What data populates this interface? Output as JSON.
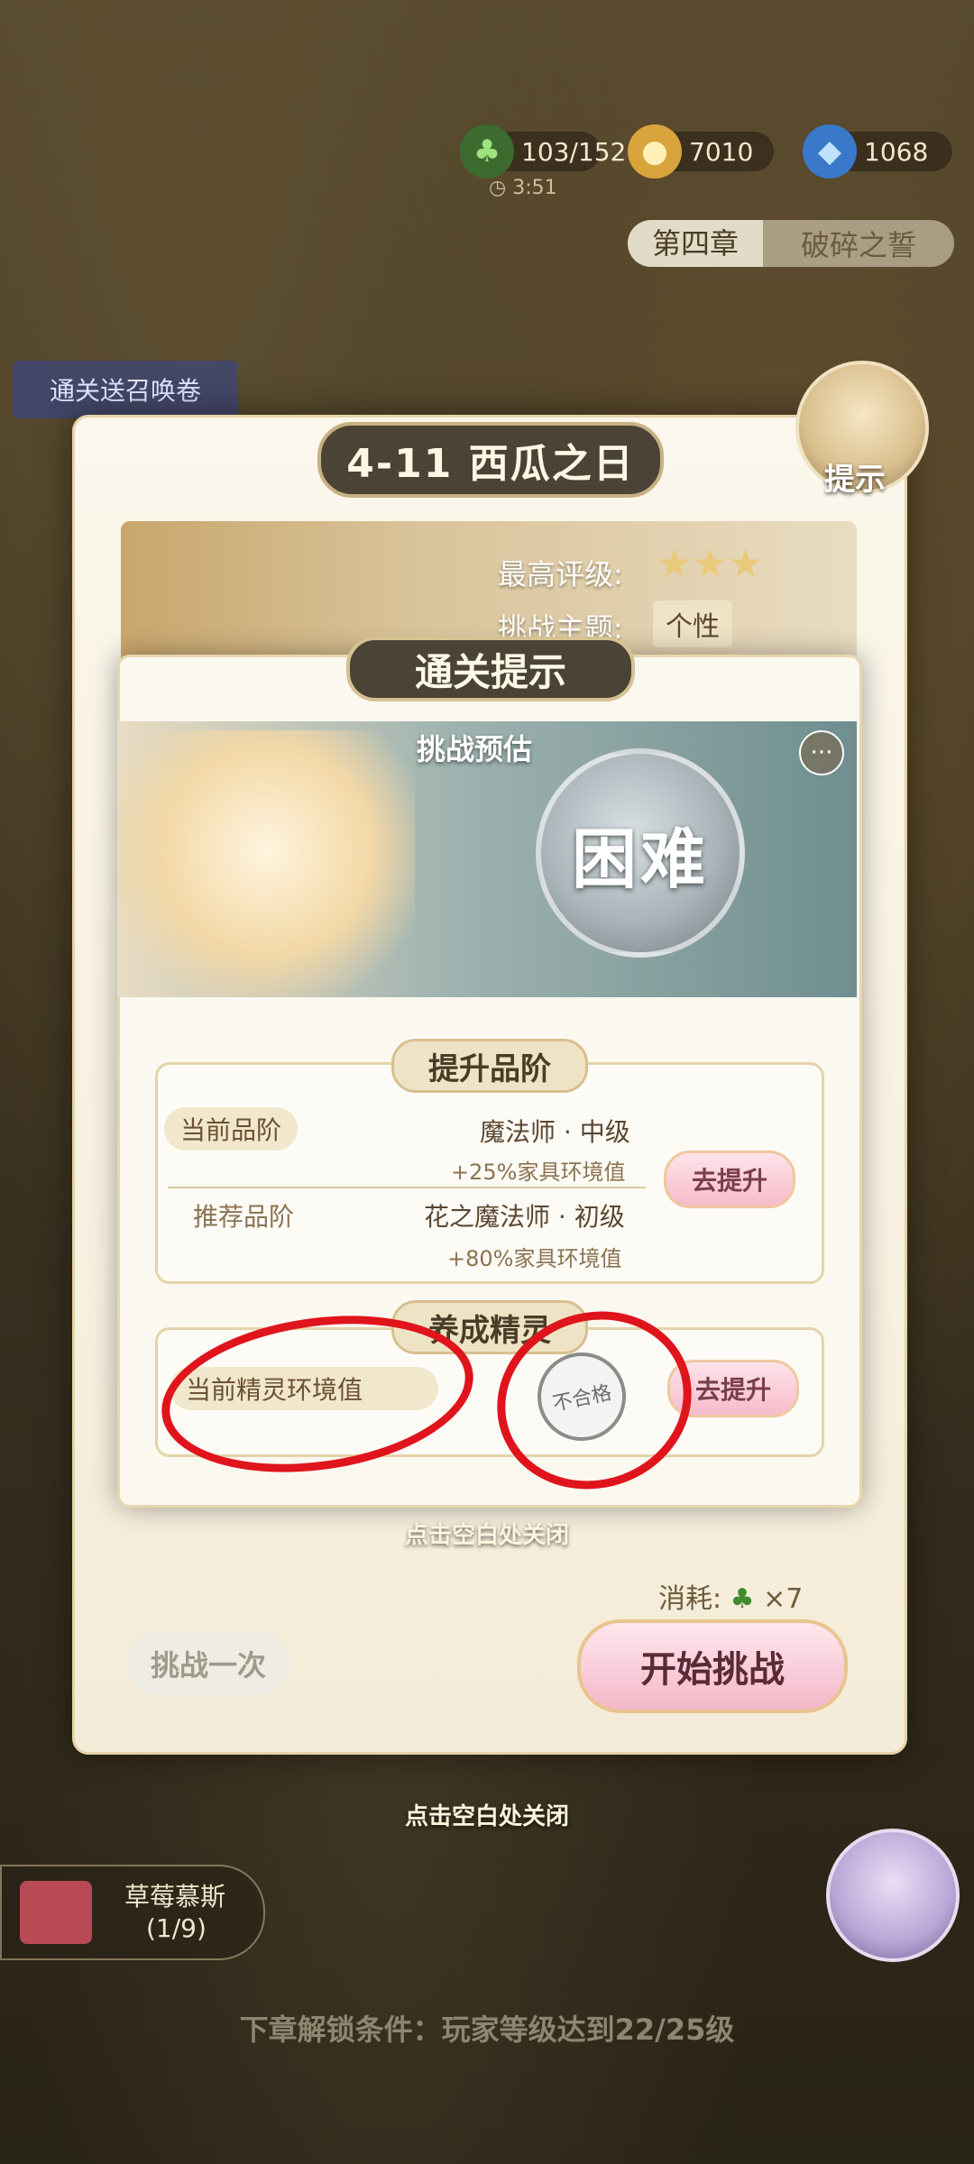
{
  "resources": {
    "clover": "103/152",
    "clover_timer": "3:51",
    "coins": "7010",
    "gems": "1068"
  },
  "chapter": {
    "number": "第四章",
    "name": "破碎之誓"
  },
  "reward_badge": "通关送召唤卷",
  "hint_avatar_label": "提示",
  "stage": {
    "title": "4-11 西瓜之日",
    "best_rating_label": "最高评级:",
    "theme_label": "挑战主题:",
    "theme_value": "个性"
  },
  "dialog": {
    "title": "通关提示",
    "estimate_label": "挑战预估",
    "difficulty": "困难",
    "more": "···",
    "upgrade_rank": {
      "tag": "提升品阶",
      "current_label": "当前品阶",
      "current_value": "魔法师 · 中级",
      "current_bonus": "+25%家具环境值",
      "recommend_label": "推荐品阶",
      "recommend_value": "花之魔法师 · 初级",
      "recommend_bonus": "+80%家具环境值",
      "button": "去提升"
    },
    "train_spirit": {
      "tag": "养成精灵",
      "current_label": "当前精灵环境值",
      "status_stamp": "不合格",
      "button": "去提升"
    },
    "close_hint": "点击空白处关闭"
  },
  "footer": {
    "cost_label": "消耗:",
    "cost_value": "×7",
    "challenge_once": "挑战一次",
    "start_challenge": "开始挑战",
    "close_hint": "点击空白处关闭"
  },
  "bottom": {
    "item_name": "草莓慕斯",
    "item_progress": "(1/9)",
    "unlock_text": "下章解锁条件：玩家等级达到22/25级"
  },
  "colors": {
    "annotation_red": "#e0141c",
    "accent_pink": "#f3b8c8",
    "panel_cream": "#fbf8f0"
  }
}
